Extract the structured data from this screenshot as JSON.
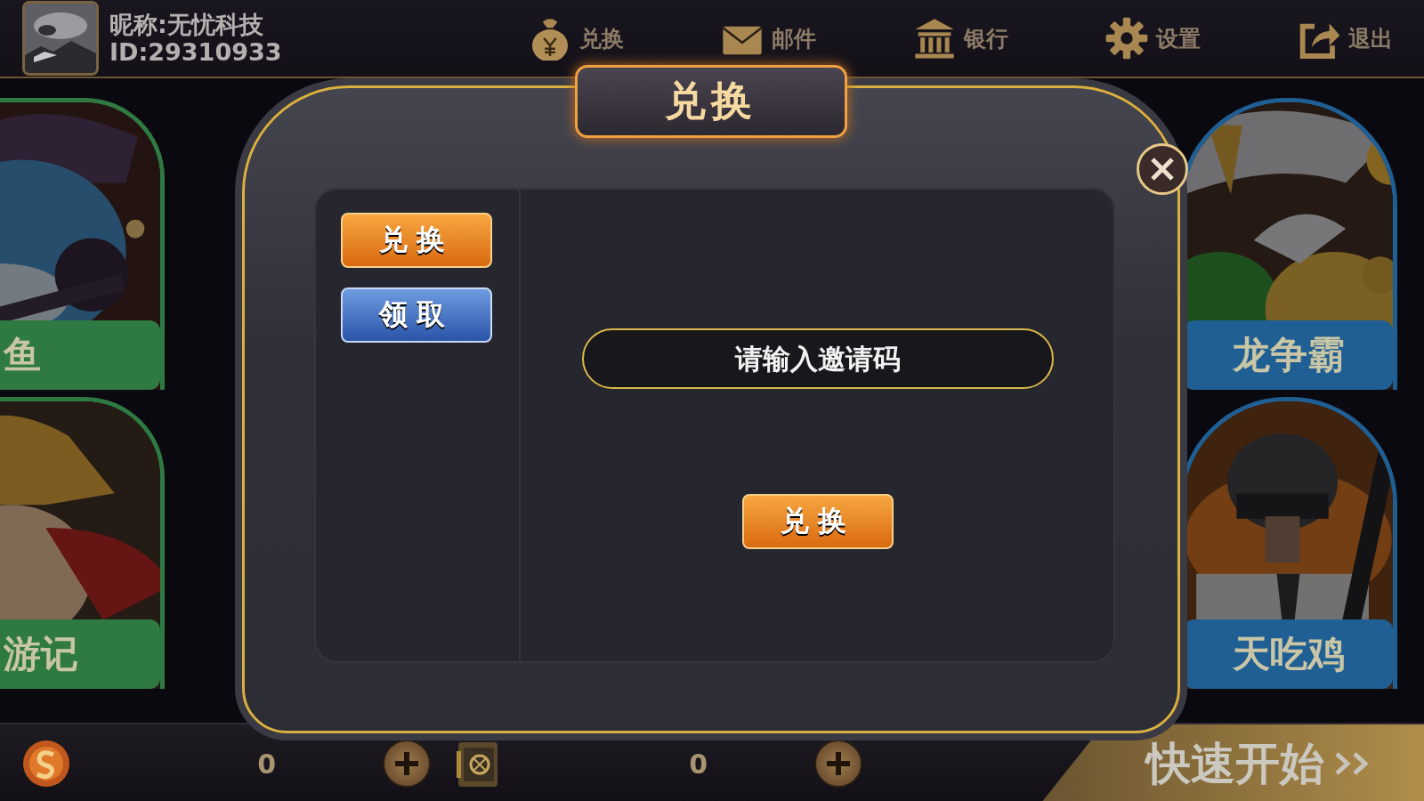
{
  "top_bar": {
    "nickname": "昵称:无忧科技",
    "user_id": "ID:29310933",
    "nav": [
      {
        "kind": "bag",
        "label": "兑换"
      },
      {
        "kind": "mail",
        "label": "邮件"
      },
      {
        "kind": "bank",
        "label": "银行"
      },
      {
        "kind": "gear",
        "label": "设置"
      },
      {
        "kind": "exit",
        "label": "退出"
      }
    ]
  },
  "left_games": [
    {
      "label": "鱼",
      "color": "#2f7a42"
    },
    {
      "label": "游记",
      "color": "#2f7a42"
    }
  ],
  "right_games": [
    {
      "label": "龙争霸",
      "color": "#1f5f94"
    },
    {
      "label": "天吃鸡",
      "color": "#1f5f94"
    }
  ],
  "bottom_bar": {
    "balances": [
      {
        "kind": "coin",
        "amount": "0"
      },
      {
        "kind": "safe",
        "amount": "0"
      }
    ],
    "quick_start": "快速开始"
  },
  "dialog": {
    "title": "兑换",
    "tabs": [
      {
        "label": "兑换",
        "selected": true
      },
      {
        "label": "领取",
        "selected": false
      }
    ],
    "code_field": {
      "placeholder": "请输入邀请码"
    },
    "submit": "兑换"
  }
}
